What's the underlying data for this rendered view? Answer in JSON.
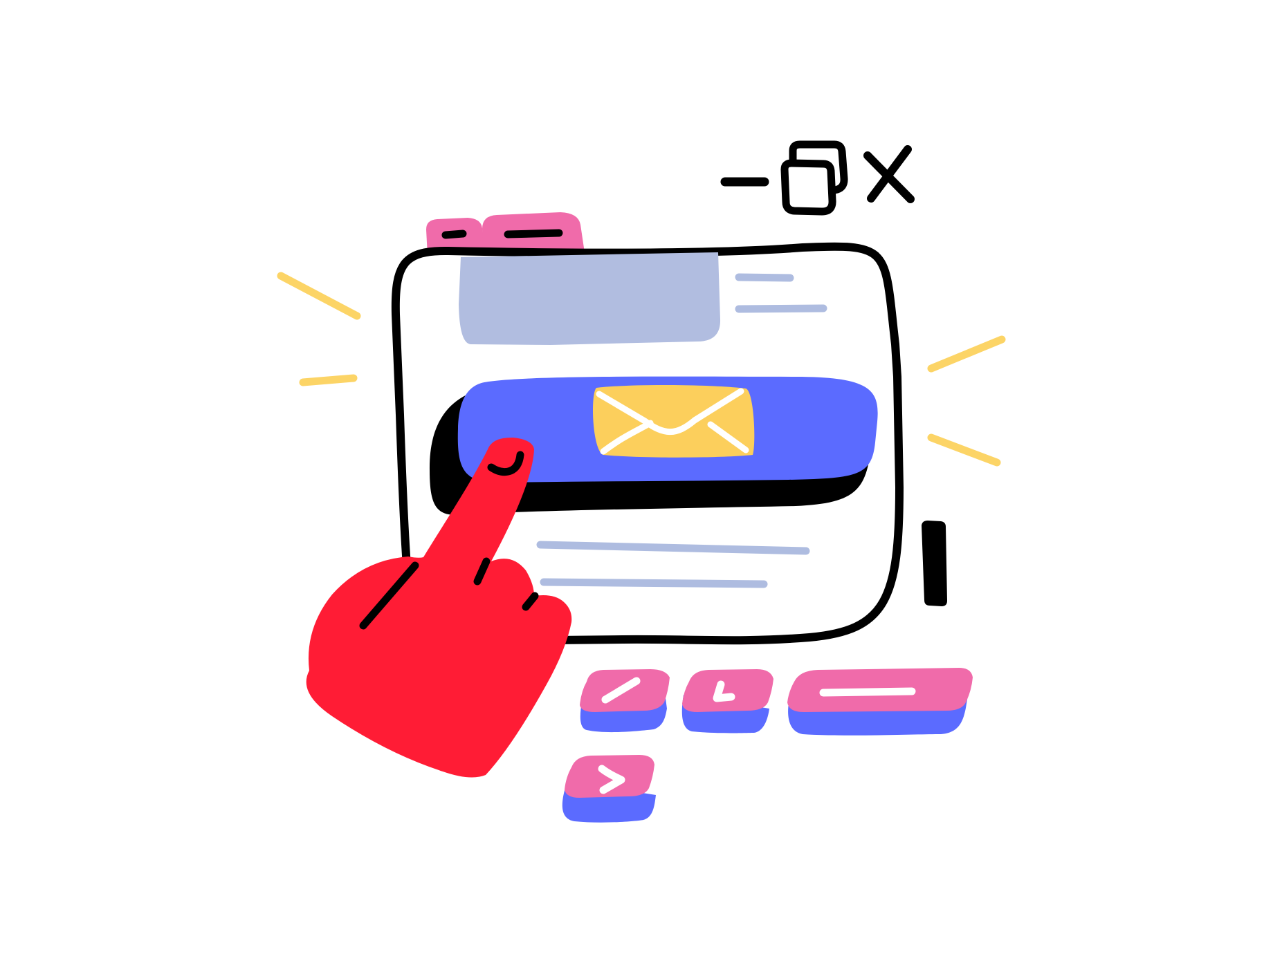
{
  "illustration": {
    "subject": "hand-clicking-email-window",
    "colors": {
      "outline": "#000000",
      "background": "#ffffff",
      "tab_pink": "#F06BAA",
      "header_lavender": "#B1BDE0",
      "text_line_lavender": "#AEBCE0",
      "email_button_blue": "#5B6BFF",
      "envelope_yellow": "#FCCF5C",
      "sparkle_yellow": "#FCD466",
      "hand_red": "#FF1C35",
      "key_pink": "#F06BAA",
      "key_blue": "#5B6BFF",
      "key_symbol_white": "#ffffff"
    }
  },
  "window_controls": {
    "icons": [
      "minimize-icon",
      "restore-icon",
      "close-icon"
    ]
  },
  "tabs": {
    "icons": [
      "tab-short-line",
      "tab-long-line"
    ]
  },
  "email_button": {
    "icon": "envelope-icon"
  },
  "keyboard": {
    "keys": [
      {
        "name": "key-slash",
        "icon": "slash-icon"
      },
      {
        "name": "key-enter",
        "icon": "enter-arrow-icon"
      },
      {
        "name": "key-space",
        "icon": "space-bar-icon"
      },
      {
        "name": "key-greater-than",
        "icon": "chevron-right-icon"
      }
    ]
  },
  "cursor": {
    "icon": "text-cursor-icon"
  },
  "pointer": {
    "icon": "pointing-hand-icon"
  }
}
